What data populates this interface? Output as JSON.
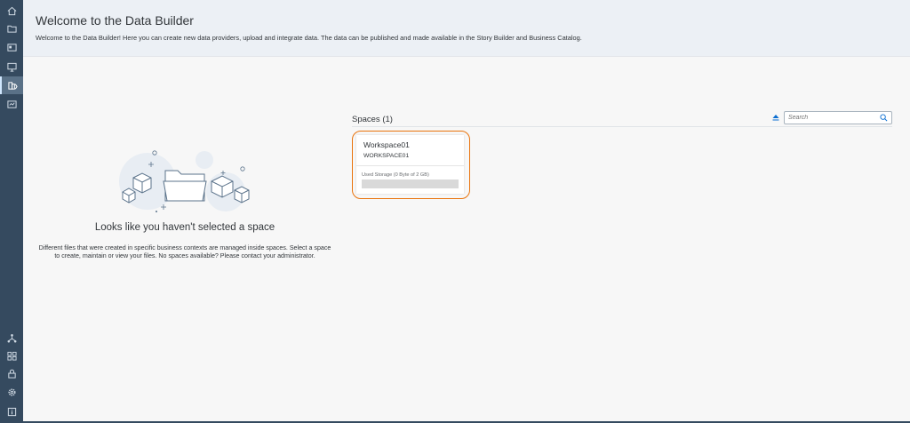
{
  "nav": {
    "items": [
      {
        "name": "home",
        "icon": "home-icon",
        "active": false
      },
      {
        "name": "repository",
        "icon": "folder-icon",
        "active": false
      },
      {
        "name": "catalog",
        "icon": "catalog-icon",
        "active": false
      },
      {
        "name": "stories",
        "icon": "presentation-icon",
        "active": false
      },
      {
        "name": "data-builder",
        "icon": "data-builder-icon",
        "active": true
      },
      {
        "name": "business-builder",
        "icon": "business-builder-icon",
        "active": false
      }
    ],
    "bottom_items": [
      {
        "name": "network",
        "icon": "network-icon"
      },
      {
        "name": "space-management",
        "icon": "space-icon"
      },
      {
        "name": "security",
        "icon": "lock-icon"
      },
      {
        "name": "system",
        "icon": "gear-icon"
      },
      {
        "name": "info",
        "icon": "info-icon"
      }
    ]
  },
  "header": {
    "title": "Welcome to the Data Builder",
    "description": "Welcome to the Data Builder! Here you can create new data providers, upload and integrate data. The data can be published and made available in the Story Builder and Business Catalog."
  },
  "empty_state": {
    "title": "Looks like you haven't selected a space",
    "description": "Different files that were created in specific business contexts are managed inside spaces. Select a space to create, maintain or view your files. No spaces available? Please contact your administrator."
  },
  "spaces": {
    "heading": "Spaces (1)",
    "search_placeholder": "Search",
    "cards": [
      {
        "name": "Workspace01",
        "id": "WORKSPACE01",
        "storage_label": "Used Storage (0 Byte of 2 GB)",
        "storage_fraction": 0
      }
    ]
  },
  "colors": {
    "nav_bg": "#354a5f",
    "header_bg": "#ecf0f5",
    "highlight": "#e9730c"
  }
}
